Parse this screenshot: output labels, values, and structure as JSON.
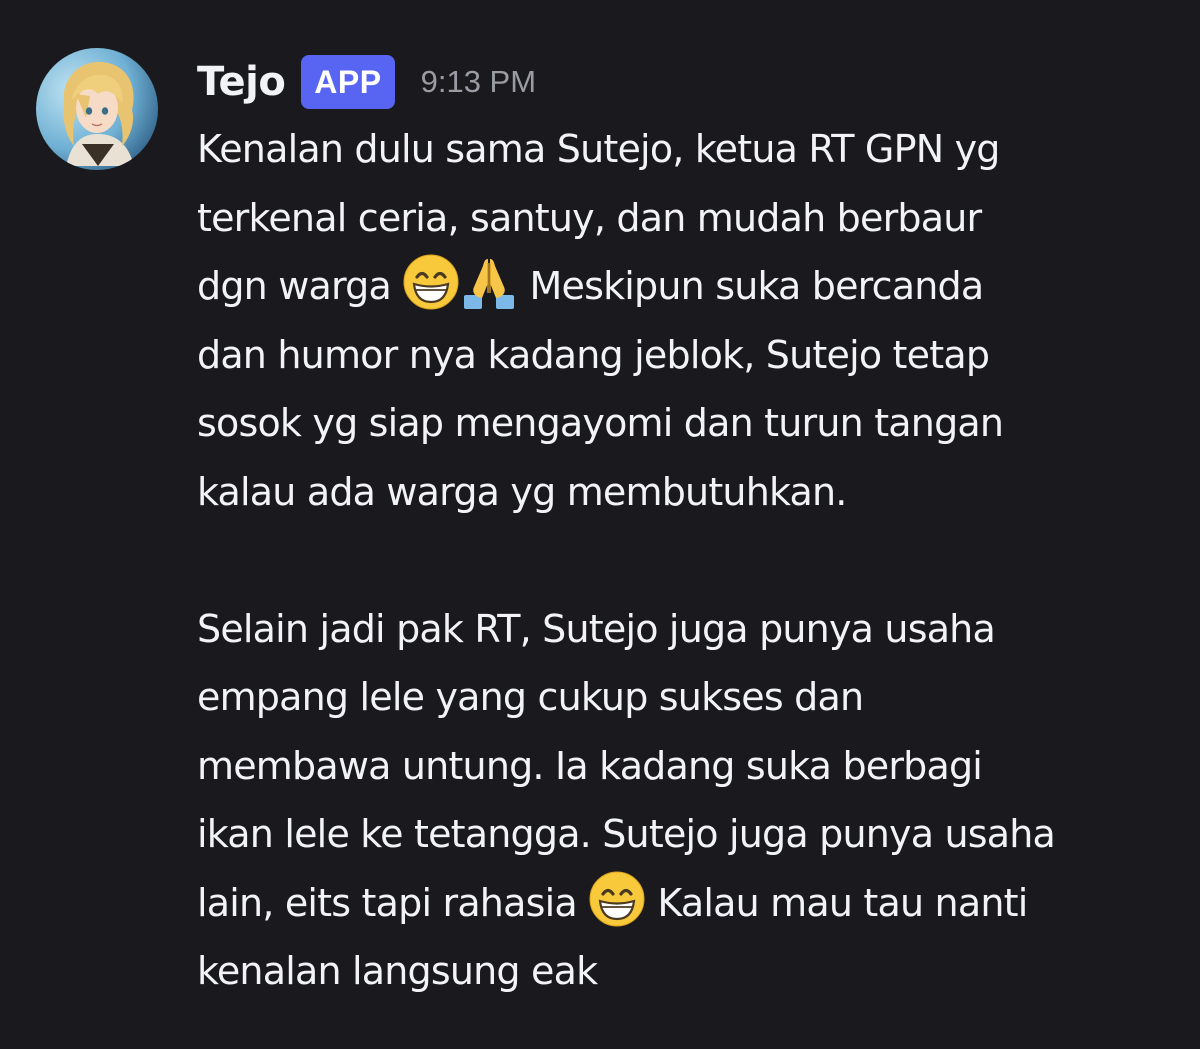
{
  "message": {
    "author": "Tejo",
    "badge": "APP",
    "timestamp": "9:13 PM",
    "avatar_icon": "anime-character-avatar",
    "paragraph1": {
      "l1": "Kenalan dulu sama Sutejo, ketua RT GPN yg",
      "l2": "terkenal ceria, santuy, dan mudah berbaur",
      "l3a": "dgn warga",
      "l3b": "Meskipun suka bercanda",
      "l4": "dan humor nya kadang jeblok, Sutejo tetap",
      "l5": "sosok yg siap mengayomi dan turun tangan",
      "l6": "kalau ada warga yg membutuhkan."
    },
    "paragraph2": {
      "l1": "Selain jadi pak RT, Sutejo juga punya usaha",
      "l2": "empang lele yang cukup sukses dan",
      "l3": "membawa untung. Ia kadang suka berbagi",
      "l4": "ikan lele ke tetangga. Sutejo juga punya usaha",
      "l5a": "lain, eits tapi rahasia",
      "l5b": "Kalau mau tau nanti",
      "l6": "kenalan langsung eak"
    },
    "emojis": [
      "grinning-face-icon",
      "folded-hands-icon",
      "grinning-face-icon"
    ]
  },
  "colors": {
    "background": "#1a1a1e",
    "text": "#f2f3f5",
    "badge": "#5865f2",
    "timestamp": "#9a9ba3"
  }
}
